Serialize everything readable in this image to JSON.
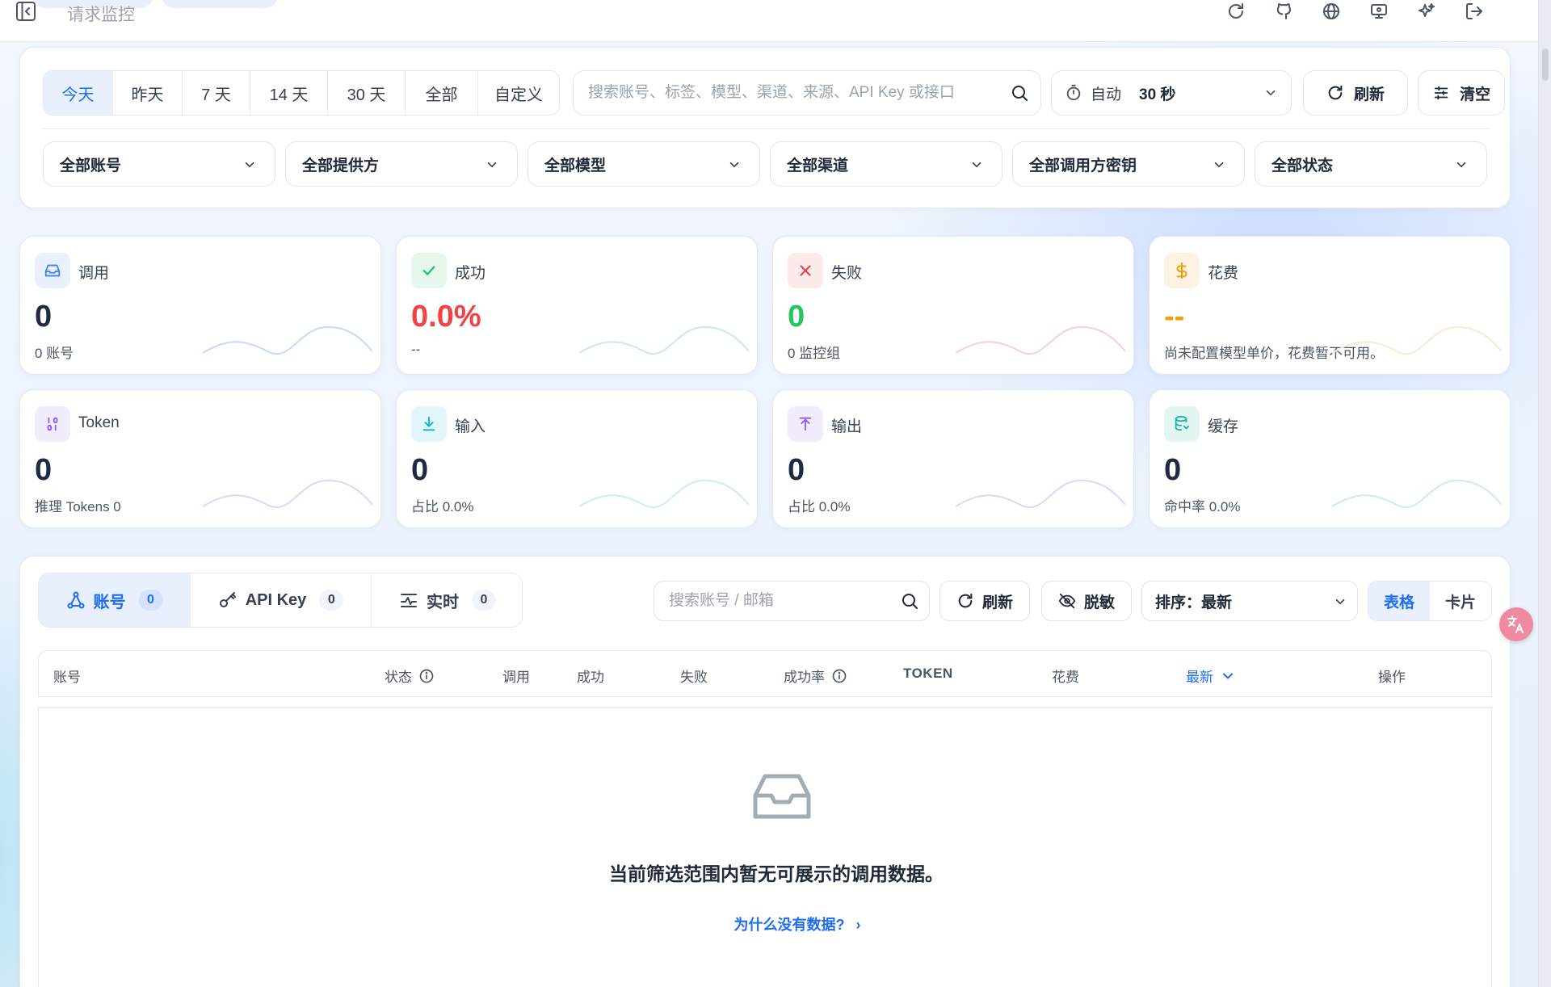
{
  "topbar": {
    "title": "请求监控",
    "icons": [
      "refresh-icon",
      "github-icon",
      "globe-icon",
      "monitor-icon",
      "sparkle-icon",
      "logout-icon"
    ]
  },
  "filters": {
    "time_tabs": [
      "今天",
      "昨天",
      "7 天",
      "14 天",
      "30 天",
      "全部",
      "自定义"
    ],
    "active_time_tab": "今天",
    "search_placeholder": "搜索账号、标签、模型、渠道、来源、API Key 或接口",
    "auto_label": "自动",
    "auto_value": "30 秒",
    "refresh_label": "刷新",
    "clear_label": "清空",
    "dropdowns": [
      "全部账号",
      "全部提供方",
      "全部模型",
      "全部渠道",
      "全部调用方密钥",
      "全部状态"
    ]
  },
  "stats": [
    {
      "label": "调用",
      "value": "0",
      "sub": "0 账号",
      "icon": "inbox-icon",
      "color": "#3b82f6"
    },
    {
      "label": "成功",
      "value": "0.0%",
      "sub": "--",
      "icon": "check-icon",
      "color": "#22c55e",
      "value_color": "#ef4444"
    },
    {
      "label": "失败",
      "value": "0",
      "sub": "0 监控组",
      "icon": "x-icon",
      "color": "#ef4444",
      "value_color": "#22c55e"
    },
    {
      "label": "花费",
      "value": "--",
      "sub": "尚未配置模型单价，花费暂不可用。",
      "icon": "dollar-icon",
      "color": "#f59e0b",
      "value_color": "#f59e0b"
    },
    {
      "label": "Token",
      "value": "0",
      "sub": "推理 Tokens 0",
      "icon": "binary-icon",
      "color": "#8b5cf6"
    },
    {
      "label": "输入",
      "value": "0",
      "sub": "占比 0.0%",
      "icon": "download-icon",
      "color": "#06b6d4"
    },
    {
      "label": "输出",
      "value": "0",
      "sub": "占比 0.0%",
      "icon": "upload-icon",
      "color": "#8b5cf6"
    },
    {
      "label": "缓存",
      "value": "0",
      "sub": "命中率 0.0%",
      "icon": "database-icon",
      "color": "#14b8a6"
    }
  ],
  "table": {
    "tabs": [
      {
        "label": "账号",
        "count": "0",
        "icon": "network-icon"
      },
      {
        "label": "API Key",
        "count": "0",
        "icon": "key-icon"
      },
      {
        "label": "实时",
        "count": "0",
        "icon": "activity-icon"
      }
    ],
    "search_placeholder": "搜索账号 / 邮箱",
    "refresh_label": "刷新",
    "mask_label": "脱敏",
    "sort_label": "排序：最新",
    "view_table": "表格",
    "view_card": "卡片",
    "columns": [
      "账号",
      "状态",
      "调用",
      "成功",
      "失败",
      "成功率",
      "TOKEN",
      "花费",
      "最新",
      "操作"
    ],
    "empty_text": "当前筛选范围内暂无可展示的调用数据。",
    "why_link": "为什么没有数据?",
    "why_arrow": "›"
  },
  "colors": {
    "accent": "#1d6cf2",
    "accent_bg": "#e8f0fd"
  }
}
